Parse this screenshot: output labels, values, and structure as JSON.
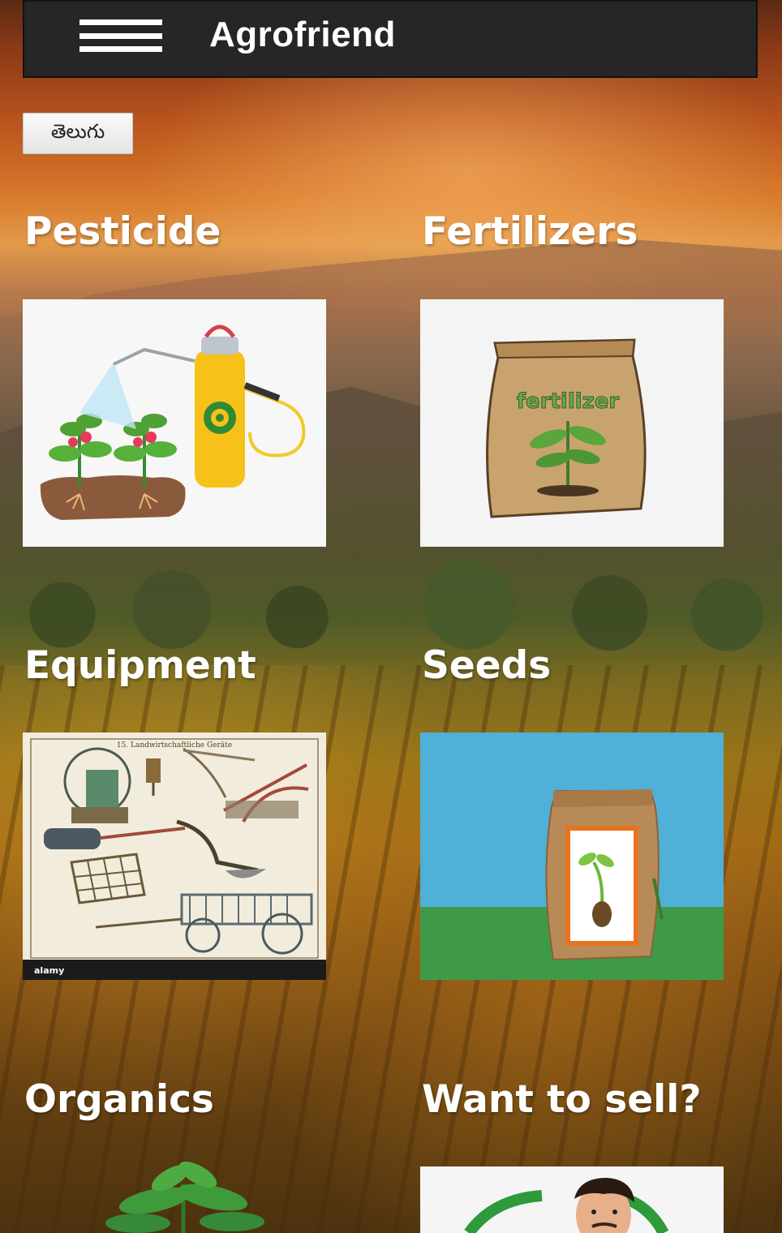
{
  "header": {
    "title": "Agrofriend",
    "menu_icon": "hamburger-menu-icon"
  },
  "language_button": {
    "label": "తెలుగు"
  },
  "categories": [
    {
      "label": "Pesticide",
      "image": "pesticide-sprayer-illustration"
    },
    {
      "label": "Fertilizers",
      "image": "fertilizer-bag-illustration",
      "bag_text": "fertilizer"
    },
    {
      "label": "Equipment",
      "image": "farm-equipment-engraving",
      "caption": "15. Landwirtschaftliche Geräte",
      "watermark": "alamy"
    },
    {
      "label": "Seeds",
      "image": "seed-bag-illustration"
    },
    {
      "label": "Organics",
      "image": "organic-plant-illustration"
    },
    {
      "label": "Want to sell?",
      "image": "seller-portrait-illustration"
    }
  ],
  "colors": {
    "appbar": "#262626",
    "label_text": "#ffffff"
  }
}
